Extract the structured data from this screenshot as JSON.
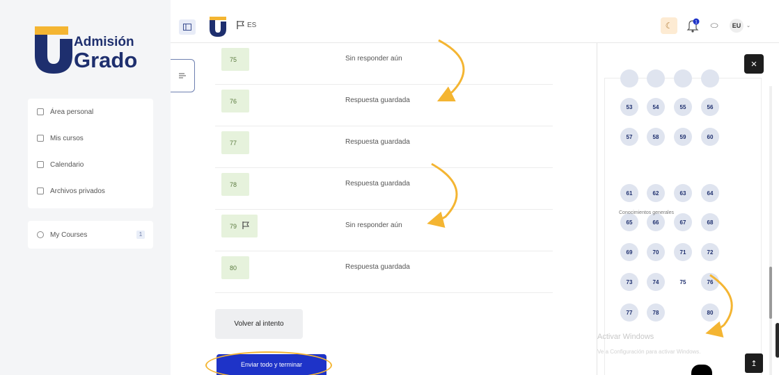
{
  "brand": {
    "line1": "Admisión",
    "line2": "Grado",
    "colors": {
      "navy": "#1e2f6e",
      "gold": "#f4b532"
    }
  },
  "topbar": {
    "lang_label": "ES",
    "user_initials": "EU",
    "notification_count": "1",
    "icons": [
      "sidebar-toggle-icon",
      "flag-icon",
      "moon-icon",
      "bell-icon",
      "chat-icon",
      "chevron-down-icon"
    ]
  },
  "sidebar": {
    "items": [
      {
        "label": "Área personal"
      },
      {
        "label": "Mis cursos"
      },
      {
        "label": "Calendario"
      },
      {
        "label": "Archivos privados"
      }
    ],
    "my_courses": {
      "label": "My Courses",
      "count": "1"
    }
  },
  "main": {
    "questions": [
      {
        "num": "75",
        "status": "Sin responder aún",
        "flagged": false
      },
      {
        "num": "76",
        "status": "Respuesta guardada",
        "flagged": false
      },
      {
        "num": "77",
        "status": "Respuesta guardada",
        "flagged": false
      },
      {
        "num": "78",
        "status": "Respuesta guardada",
        "flagged": false
      },
      {
        "num": "79",
        "status": "Sin responder aún",
        "flagged": true
      },
      {
        "num": "80",
        "status": "Respuesta guardada",
        "flagged": false
      }
    ],
    "back_label": "Volver al intento",
    "submit_label": "Enviar todo y terminar"
  },
  "drawer": {
    "section_label": "Conocimientos generales",
    "watermark_title": "Activar Windows",
    "watermark_sub": "Ve a Configuración para activar Windows.",
    "close_label": "×",
    "download_label": "↥",
    "nav_buttons": [
      {
        "label": "",
        "col": 0,
        "row": -1
      },
      {
        "label": "",
        "col": 1,
        "row": -1
      },
      {
        "label": "",
        "col": 2,
        "row": -1
      },
      {
        "label": "",
        "col": 3,
        "row": -1
      },
      {
        "label": "53",
        "col": 0,
        "row": 0
      },
      {
        "label": "54",
        "col": 1,
        "row": 0
      },
      {
        "label": "55",
        "col": 2,
        "row": 0
      },
      {
        "label": "56",
        "col": 3,
        "row": 0
      },
      {
        "label": "57",
        "col": 0,
        "row": 1
      },
      {
        "label": "58",
        "col": 1,
        "row": 1
      },
      {
        "label": "59",
        "col": 2,
        "row": 1
      },
      {
        "label": "60",
        "col": 3,
        "row": 1
      },
      {
        "label": "61",
        "col": 0,
        "row": 2
      },
      {
        "label": "62",
        "col": 1,
        "row": 2
      },
      {
        "label": "63",
        "col": 2,
        "row": 2
      },
      {
        "label": "64",
        "col": 3,
        "row": 2
      },
      {
        "label": "65",
        "col": 0,
        "row": 3
      },
      {
        "label": "66",
        "col": 1,
        "row": 3
      },
      {
        "label": "67",
        "col": 2,
        "row": 3
      },
      {
        "label": "68",
        "col": 3,
        "row": 3
      },
      {
        "label": "69",
        "col": 0,
        "row": 4
      },
      {
        "label": "70",
        "col": 1,
        "row": 4
      },
      {
        "label": "71",
        "col": 2,
        "row": 4
      },
      {
        "label": "72",
        "col": 3,
        "row": 4
      },
      {
        "label": "73",
        "col": 0,
        "row": 5
      },
      {
        "label": "74",
        "col": 1,
        "row": 5
      },
      {
        "label": "75",
        "col": 2,
        "row": 5,
        "current": true
      },
      {
        "label": "76",
        "col": 3,
        "row": 5
      },
      {
        "label": "77",
        "col": 0,
        "row": 6
      },
      {
        "label": "78",
        "col": 1,
        "row": 6
      },
      {
        "label": "",
        "col": 2,
        "row": 6,
        "hidden": true
      },
      {
        "label": "80",
        "col": 3,
        "row": 6
      }
    ]
  }
}
